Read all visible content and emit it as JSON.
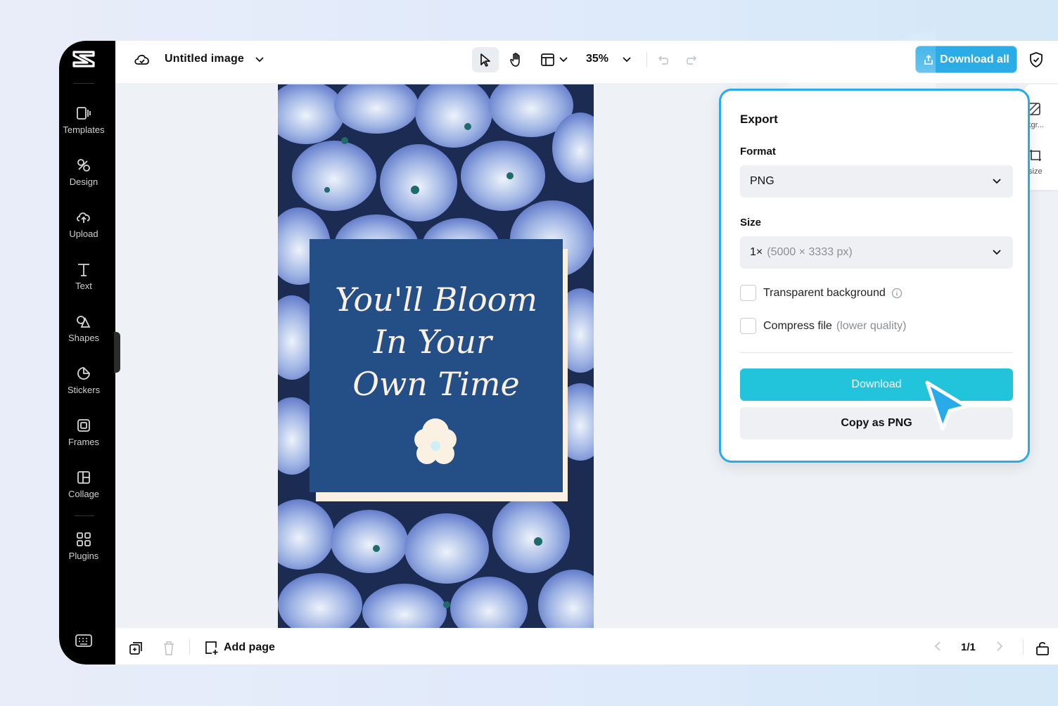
{
  "app": {
    "logo": "capcut-logo"
  },
  "sidebar": {
    "items": [
      {
        "label": "Templates",
        "icon": "templates-icon"
      },
      {
        "label": "Design",
        "icon": "design-icon"
      },
      {
        "label": "Upload",
        "icon": "upload-icon"
      },
      {
        "label": "Text",
        "icon": "text-icon"
      },
      {
        "label": "Shapes",
        "icon": "shapes-icon"
      },
      {
        "label": "Stickers",
        "icon": "stickers-icon"
      },
      {
        "label": "Frames",
        "icon": "frames-icon"
      },
      {
        "label": "Collage",
        "icon": "collage-icon"
      },
      {
        "label": "Plugins",
        "icon": "plugins-icon"
      }
    ]
  },
  "topbar": {
    "title": "Untitled image",
    "zoom": "35%",
    "download_all_label": "Download all"
  },
  "canvas": {
    "poster_lines": [
      "You'll Bloom",
      "In Your",
      "Own Time"
    ]
  },
  "rail": {
    "items": [
      "kgr...",
      "size"
    ]
  },
  "export": {
    "title": "Export",
    "format_label": "Format",
    "format_value": "PNG",
    "size_label": "Size",
    "size_value": "1×",
    "size_detail": "(5000 × 3333 px)",
    "transparent_label": "Transparent background",
    "compress_label": "Compress file",
    "compress_hint": "(lower quality)",
    "download_label": "Download",
    "copy_label": "Copy as PNG"
  },
  "bottombar": {
    "add_page_label": "Add page",
    "page_indicator": "1/1"
  },
  "colors": {
    "accent": "#28abe8",
    "download_button": "#22c4dc",
    "poster_panel": "#244f86",
    "poster_text": "#fbf1e3"
  }
}
